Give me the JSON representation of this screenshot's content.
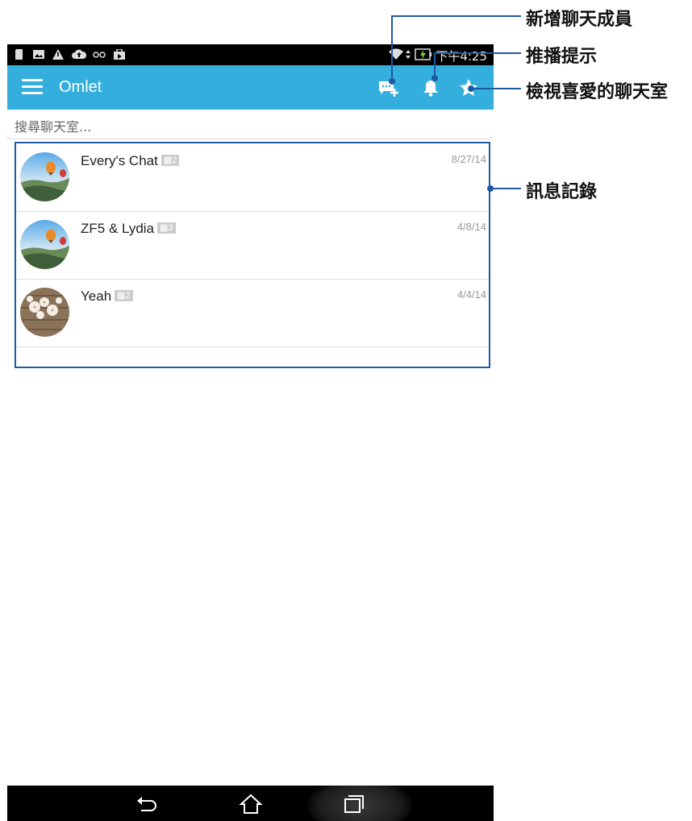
{
  "status_bar": {
    "time": "下午4:25"
  },
  "action_bar": {
    "title": "Omlet"
  },
  "search": {
    "placeholder": "搜尋聊天室..."
  },
  "chats": [
    {
      "name": "Every's Chat",
      "members": "2",
      "date": "8/27/14",
      "avatar": "hot-air-balloon-landscape"
    },
    {
      "name": "ZF5 & Lydia",
      "members": "3",
      "date": "4/8/14",
      "avatar": "hot-air-balloon-landscape"
    },
    {
      "name": "Yeah",
      "members": "2",
      "date": "4/4/14",
      "avatar": "white-flowers-on-wood"
    }
  ],
  "callouts": {
    "add_member": "新增聊天成員",
    "notifications": "推播提示",
    "favorites": "檢視喜愛的聊天室",
    "history": "訊息記錄"
  },
  "icons": {
    "menu": "menu-icon",
    "add_member": "add-chat-member-icon",
    "bell": "bell-icon",
    "star": "star-icon",
    "back": "back-icon",
    "home": "home-icon",
    "recents": "recent-apps-icon"
  },
  "colors": {
    "action_bar": "#34aedc",
    "callout_line": "#1d5aa3",
    "status_bar": "#000000"
  }
}
